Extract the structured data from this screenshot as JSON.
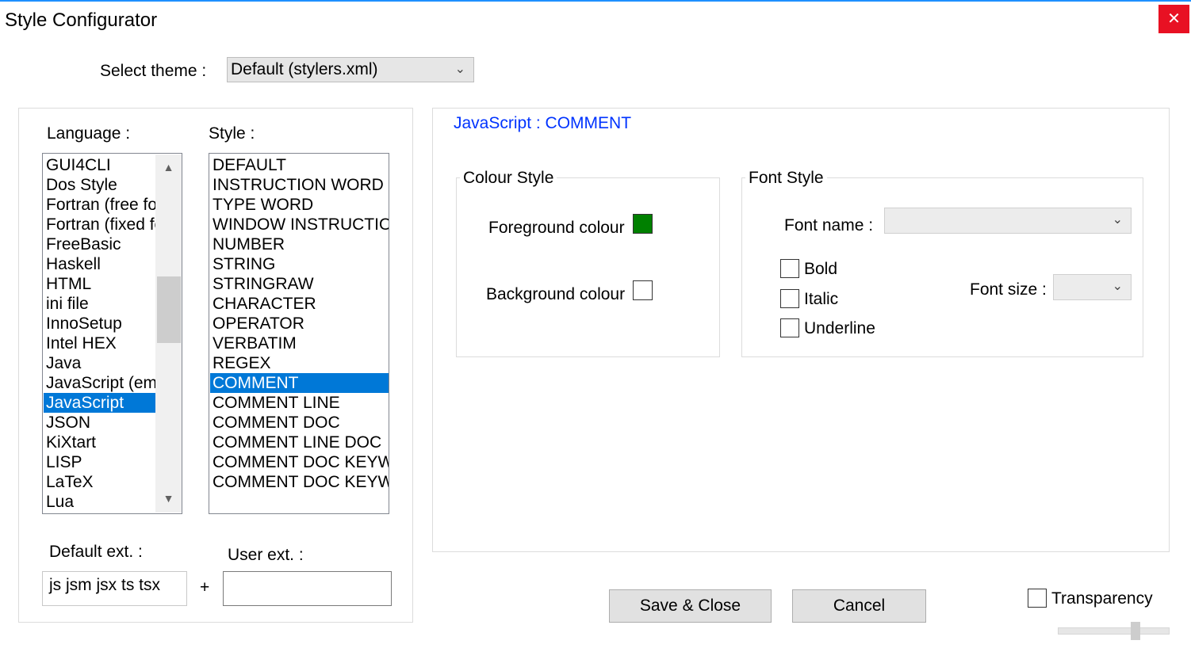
{
  "window": {
    "title": "Style Configurator",
    "close_label": "✕"
  },
  "theme": {
    "label": "Select theme :",
    "value": "Default (stylers.xml)"
  },
  "language": {
    "label": "Language :",
    "items": [
      "GUI4CLI",
      "Dos Style",
      "Fortran (free form)",
      "Fortran (fixed form)",
      "FreeBasic",
      "Haskell",
      "HTML",
      "ini file",
      "InnoSetup",
      "Intel HEX",
      "Java",
      "JavaScript (embedded)",
      "JavaScript",
      "JSON",
      "KiXtart",
      "LISP",
      "LaTeX",
      "Lua"
    ],
    "selected": "JavaScript"
  },
  "style": {
    "label": "Style :",
    "items": [
      "DEFAULT",
      "INSTRUCTION WORD",
      "TYPE WORD",
      "WINDOW INSTRUCTION",
      "NUMBER",
      "STRING",
      "STRINGRAW",
      "CHARACTER",
      "OPERATOR",
      "VERBATIM",
      "REGEX",
      "COMMENT",
      "COMMENT LINE",
      "COMMENT DOC",
      "COMMENT LINE DOC",
      "COMMENT DOC KEYWORD",
      "COMMENT DOC KEYWORD ERROR"
    ],
    "selected": "COMMENT"
  },
  "ext": {
    "default_label": "Default ext. :",
    "default_value": "js jsm jsx ts tsx",
    "plus": "+",
    "user_label": "User ext. :",
    "user_value": ""
  },
  "detail": {
    "title": "JavaScript : COMMENT"
  },
  "colour_style": {
    "title": "Colour Style",
    "foreground_label": "Foreground colour",
    "foreground_color": "#008000",
    "background_label": "Background colour",
    "background_color": "#ffffff"
  },
  "font_style": {
    "title": "Font Style",
    "font_name_label": "Font name :",
    "font_name_value": "",
    "font_size_label": "Font size :",
    "font_size_value": "",
    "bold_label": "Bold",
    "italic_label": "Italic",
    "underline_label": "Underline"
  },
  "buttons": {
    "save": "Save & Close",
    "cancel": "Cancel"
  },
  "transparency": {
    "label": "Transparency"
  }
}
